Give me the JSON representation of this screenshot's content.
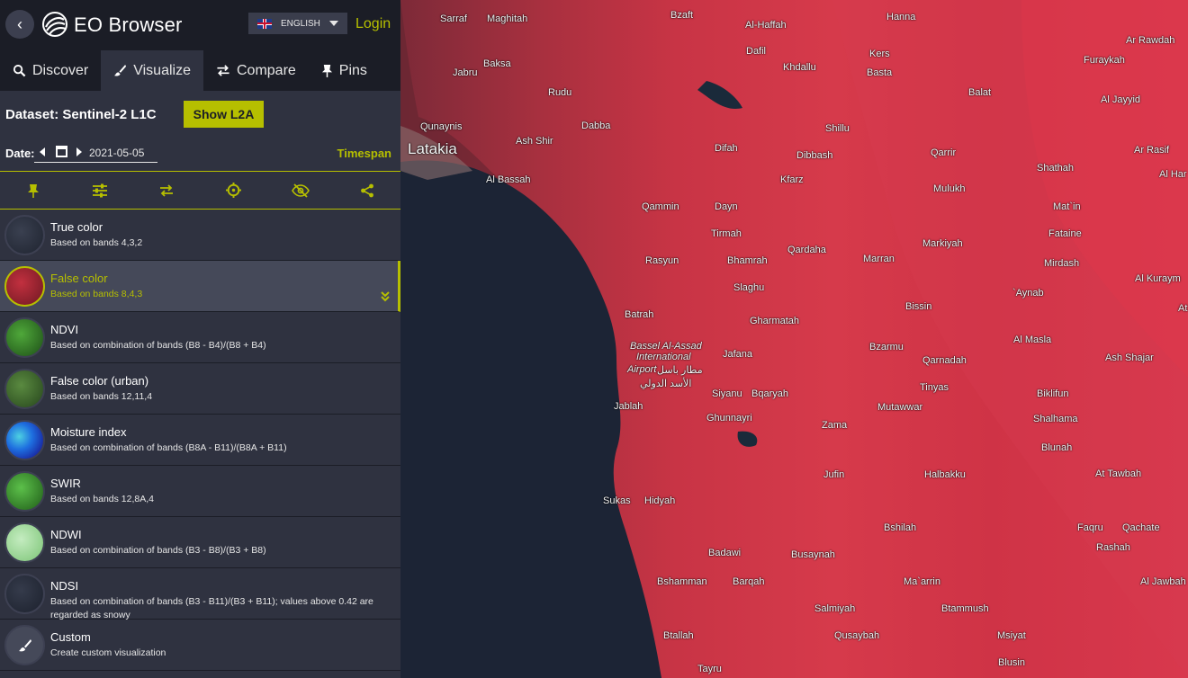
{
  "header": {
    "title": "EO Browser",
    "language": "ENGLISH",
    "login": "Login"
  },
  "tabs": [
    {
      "label": "Discover",
      "icon": "search-icon"
    },
    {
      "label": "Visualize",
      "icon": "brush-icon"
    },
    {
      "label": "Compare",
      "icon": "compare-icon"
    },
    {
      "label": "Pins",
      "icon": "pin-icon"
    }
  ],
  "dataset": {
    "label": "Dataset:",
    "name": "Sentinel-2 L1C",
    "button": "Show L2A"
  },
  "date": {
    "label": "Date:",
    "value": "2021-05-05",
    "timespan": "Timespan"
  },
  "toolbar_icons": [
    "pin-icon",
    "sliders-icon",
    "compare-icon",
    "crosshair-icon",
    "eye-off-icon",
    "share-icon"
  ],
  "layers": [
    {
      "name": "True color",
      "desc": "Based on bands 4,3,2",
      "thumb": "#2c3140"
    },
    {
      "name": "False color",
      "desc": "Based on bands 8,4,3",
      "thumb": "#8b1e2b"
    },
    {
      "name": "NDVI",
      "desc": "Based on combination of bands (B8 - B4)/(B8 + B4)",
      "thumb": "#2f7d25"
    },
    {
      "name": "False color (urban)",
      "desc": "Based on bands 12,11,4",
      "thumb": "#3c6b2d"
    },
    {
      "name": "Moisture index",
      "desc": "Based on combination of bands (B8A - B11)/(B8A + B11)",
      "thumb": "#2456c8"
    },
    {
      "name": "SWIR",
      "desc": "Based on bands 12,8A,4",
      "thumb": "#3d8a2a"
    },
    {
      "name": "NDWI",
      "desc": "Based on combination of bands (B3 - B8)/(B3 + B8)",
      "thumb": "#8fd08a"
    },
    {
      "name": "NDSI",
      "desc": "Based on combination of bands (B3 - B11)/(B3 + B11); values above 0.42 are regarded as snowy",
      "thumb": "#2a3040"
    },
    {
      "name": "Custom",
      "desc": "Create custom visualization",
      "thumb": "#454959"
    }
  ],
  "map_labels": {
    "sarraf": "Sarraf",
    "maghitah": "Maghitah",
    "bzaft": "Bzaft",
    "hanna": "Hanna",
    "ar_rawdah": "Ar Rawdah",
    "al_haffah": "Al-Haffah",
    "dafil": "Dafil",
    "kers": "Kers",
    "jabru": "Jabru",
    "baksa": "Baksa",
    "khdallu": "Khdallu",
    "basta": "Basta",
    "furaykah": "Furaykah",
    "rudu": "Rudu",
    "balat": "Balat",
    "al_jayyid": "Al Jayyid",
    "qunaynis": "Qunaynis",
    "dabba": "Dabba",
    "shillu": "Shillu",
    "latakia": "Latakia",
    "ash_shir": "Ash Shir",
    "difah": "Difah",
    "dibbash": "Dibbash",
    "qarrir": "Qarrir",
    "ar_rasif": "Ar Rasif",
    "shathah": "Shathah",
    "al_har": "Al Har",
    "al_bassah": "Al Bassah",
    "kfarz": "Kfarz",
    "muluk": "Mulukh",
    "qammin": "Qammin",
    "dayn": "Dayn",
    "mat_in": "Mat`in",
    "tirmah": "Tirmah",
    "markiyah": "Markiyah",
    "fataine": "Fataine",
    "qardaha": "Qardaha",
    "rasyun": "Rasyun",
    "bhamrah": "Bhamrah",
    "marran": "Marran",
    "mirdash": "Mirdash",
    "slaghu": "Slaghu",
    "aynab": "`Aynab",
    "al_kurayn": "Al Kuraym",
    "at": "At",
    "batrah": "Batrah",
    "gharmatah": "Gharmatah",
    "bissin": "Bissin",
    "bassel_1": "Bassel Al-Assad",
    "bassel_2": "International",
    "bassel_3": "Airport",
    "bassel_4": "مطار باسل",
    "bassel_5": "الأسد الدولي",
    "al_masla": "Al Masla",
    "bzarmu": "Bzarmu",
    "jafana": "Jafana",
    "qarnadah": "Qarnadah",
    "ash_shajar": "Ash Shajar",
    "siyanu": "Siyanu",
    "bqaryah": "Bqaryah",
    "tinyas": "Tinyas",
    "biklifun": "Biklifun",
    "jablah": "Jablah",
    "mutawwar": "Mutawwar",
    "ghunnayri": "Ghunnayri",
    "shalhama": "Shalhama",
    "zama": "Zama",
    "blunah": "Blunah",
    "jufin": "Jufin",
    "halbakku": "Halbakku",
    "at_tawbah": "At Tawbah",
    "sukas": "Sukas",
    "hidyah": "Hidyah",
    "bshilah": "Bshilah",
    "faqru": "Faqru",
    "qachate": "Qachate",
    "badawi": "Badawi",
    "busaynah": "Busaynah",
    "rashah": "Rashah",
    "bshamman": "Bshamman",
    "barqah": "Barqah",
    "ma_arrin": "Ma`arrin",
    "al_jawbah": "Al Jawbah",
    "salmiyah": "Salmiyah",
    "btammush": "Btammush",
    "qusaybah": "Qusaybah",
    "btallah": "Btallah",
    "msiyat": "Msiyat",
    "blusin": "Blusin",
    "tayru": "Tayru"
  },
  "colors": {
    "accent": "#b6bf00",
    "panel": "#2f3240",
    "header": "#1b1d26"
  }
}
